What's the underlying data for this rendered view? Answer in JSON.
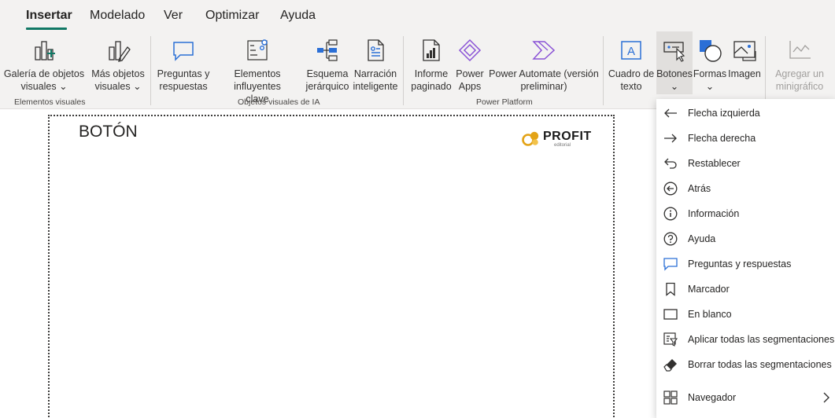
{
  "tabs": [
    {
      "label": "Insertar",
      "active": true
    },
    {
      "label": "Modelado"
    },
    {
      "label": "Ver"
    },
    {
      "label": "Optimizar"
    },
    {
      "label": "Ayuda"
    }
  ],
  "ribbon": {
    "visuals": {
      "gallery": {
        "line1": "Galería de objetos",
        "line2": "visuales ⌄"
      },
      "more": {
        "line1": "Más objetos",
        "line2": "visuales ⌄"
      },
      "group_label": "Elementos visuales"
    },
    "ai": {
      "qa": {
        "line1": "Preguntas y",
        "line2": "respuestas"
      },
      "influencers": {
        "line1": "Elementos influyentes",
        "line2": "clave"
      },
      "tree": {
        "line1": "Esquema",
        "line2": "jerárquico"
      },
      "narrative": {
        "line1": "Narración",
        "line2": "inteligente"
      },
      "group_label": "Objetos visuales de IA"
    },
    "power": {
      "report": {
        "line1": "Informe",
        "line2": "paginado"
      },
      "apps": {
        "line1": "Power",
        "line2": "Apps"
      },
      "automate": {
        "line1": "Power Automate (versión",
        "line2": "preliminar)"
      },
      "group_label": "Power Platform"
    },
    "elements": {
      "textbox": {
        "line1": "Cuadro de",
        "line2": "texto"
      },
      "buttons": {
        "line1": "Botones",
        "line2": "⌄"
      },
      "shapes": {
        "line1": "Formas",
        "line2": "⌄"
      },
      "image": {
        "line1": "Imagen",
        "line2": ""
      }
    },
    "sparkline": {
      "line1": "Agregar un",
      "line2": "minigráfico"
    }
  },
  "canvas": {
    "title": "BOTÓN",
    "logo_word": "PROFIT",
    "logo_sub": "editorial"
  },
  "menu": {
    "items": [
      {
        "label": "Flecha izquierda",
        "icon": "arrow-left-icon"
      },
      {
        "label": "Flecha derecha",
        "icon": "arrow-right-icon"
      },
      {
        "label": "Restablecer",
        "icon": "reset-icon"
      },
      {
        "label": "Atrás",
        "icon": "back-icon"
      },
      {
        "label": "Información",
        "icon": "info-icon"
      },
      {
        "label": "Ayuda",
        "icon": "help-icon"
      },
      {
        "label": "Preguntas y respuestas",
        "icon": "qa-icon"
      },
      {
        "label": "Marcador",
        "icon": "bookmark-icon"
      },
      {
        "label": "En blanco",
        "icon": "blank-icon"
      },
      {
        "label": "Aplicar todas las segmentaciones",
        "icon": "apply-slicers-icon"
      },
      {
        "label": "Borrar todas las segmentaciones",
        "icon": "clear-slicers-icon"
      },
      {
        "label": "Navegador",
        "icon": "navigator-icon"
      }
    ]
  },
  "colors": {
    "accent": "#117865",
    "ribbon_bg": "#f3f2f1",
    "icon_blue": "#2b6fd6",
    "icon_purple": "#8a52d6",
    "logo_gold": "#e3a317"
  }
}
